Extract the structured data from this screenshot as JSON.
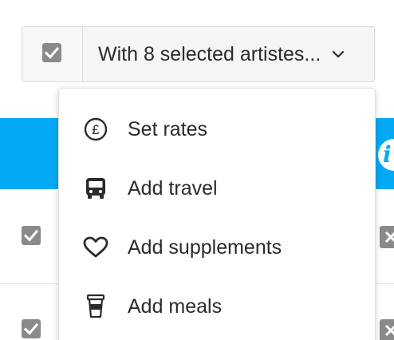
{
  "bulk_action": {
    "select_all_checked": true,
    "dropdown_label": "With 8 selected artistes..."
  },
  "table": {
    "header_color": "#03a9f4",
    "info_glyph": "i",
    "rows": [
      {
        "checked": true
      },
      {
        "checked": true
      }
    ]
  },
  "menu": {
    "items": [
      {
        "icon": "pound-coin-icon",
        "label": "Set rates"
      },
      {
        "icon": "bus-icon",
        "label": "Add travel"
      },
      {
        "icon": "heart-icon",
        "label": "Add supplements"
      },
      {
        "icon": "coffee-cup-icon",
        "label": "Add meals"
      }
    ]
  },
  "colors": {
    "accent": "#03a9f4",
    "checkbox": "#8a8a8a",
    "text": "#2b2b2b"
  }
}
